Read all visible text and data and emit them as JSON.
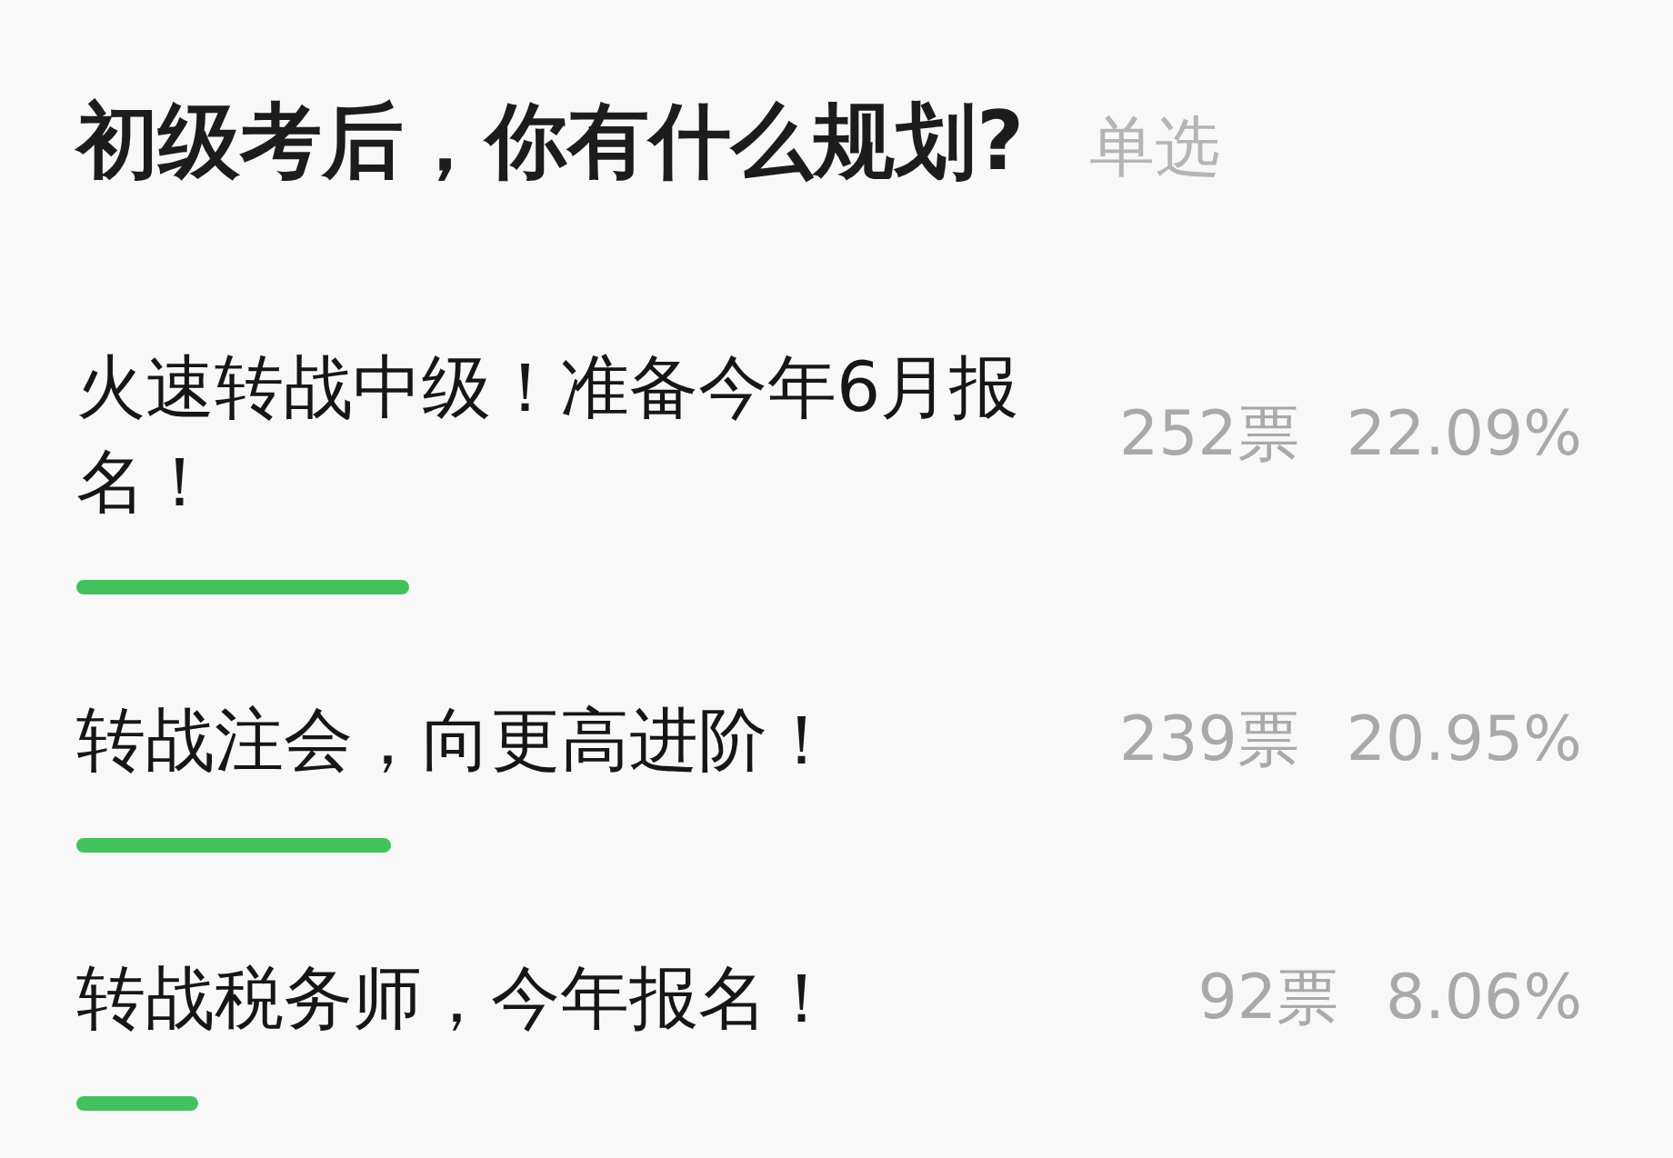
{
  "poll": {
    "question": "初级考后，你有什么规划?",
    "mode": "单选",
    "options": [
      {
        "text": "火速转战中级！准备今年6月报名！",
        "votes": "252票",
        "percent": "22.09%",
        "level": 0.2209
      },
      {
        "text": "转战注会，向更高进阶！",
        "votes": "239票",
        "percent": "20.95%",
        "level": 0.2095
      },
      {
        "text": "转战税务师，今年报名！",
        "votes": "92票",
        "percent": "8.06%",
        "level": 0.0806
      }
    ]
  }
}
